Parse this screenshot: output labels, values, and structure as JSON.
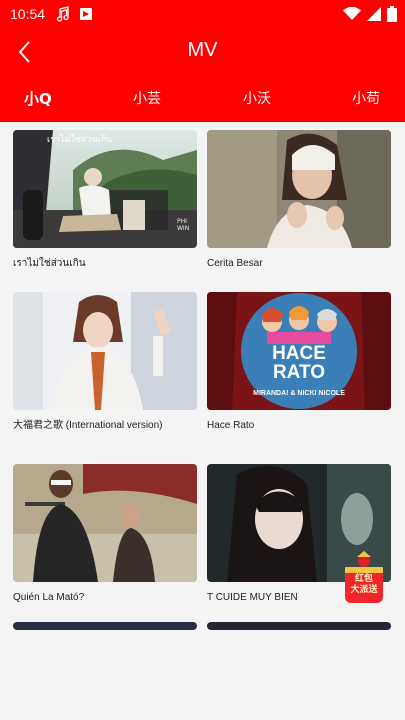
{
  "status": {
    "time": "10:54"
  },
  "header": {
    "title": "MV"
  },
  "tabs": [
    {
      "label": "小Q"
    },
    {
      "label": "小芸"
    },
    {
      "label": "小沃"
    },
    {
      "label": "小苟"
    }
  ],
  "videos": [
    {
      "caption": "เราไม่ใช่ส่วนเกิน"
    },
    {
      "caption": "Cerita Besar"
    },
    {
      "caption": "大福君之歌 (International version)"
    },
    {
      "caption": "Hace Rato"
    },
    {
      "caption": "Quién La Mató?"
    },
    {
      "caption": "T CUIDE MUY BIEN"
    }
  ],
  "thumb_text": {
    "hace_title": "HACE\nRATO",
    "hace_artists": "MIRANDA! & NICKI NICOLE",
    "thai_title": "เราไม่ใช่ส่วนเกิน",
    "phi": "PHI\nWIN"
  },
  "badge": {
    "text": "红包\n大派送"
  },
  "colors": {
    "accent": "#ff0000"
  }
}
